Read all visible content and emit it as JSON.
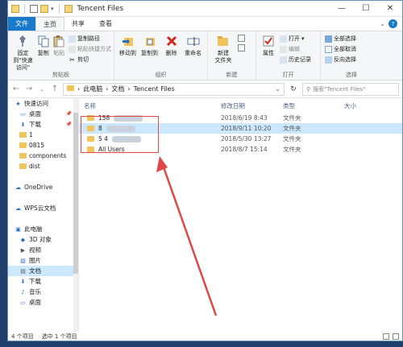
{
  "window": {
    "title": "Tencent Files"
  },
  "tabs": [
    {
      "label": "文件",
      "kind": "file"
    },
    {
      "label": "主页",
      "kind": "active"
    },
    {
      "label": "共享",
      "kind": "normal"
    },
    {
      "label": "查看",
      "kind": "normal"
    }
  ],
  "ribbon": {
    "clipboard": {
      "label": "剪贴板",
      "pin": "固定到\"快速访问\"",
      "copy": "复制",
      "paste": "粘贴",
      "copy_path": "复制路径",
      "paste_shortcut": "粘贴快捷方式",
      "cut": "剪切"
    },
    "organize": {
      "label": "组织",
      "move_to": "移动到",
      "copy_to": "复制到",
      "delete": "删除",
      "rename": "重命名"
    },
    "new": {
      "label": "新建",
      "new_folder": "新建\n文件夹"
    },
    "open": {
      "label": "打开",
      "properties": "属性",
      "open": "打开",
      "edit": "编辑",
      "history": "历史记录"
    },
    "select": {
      "label": "选择",
      "select_all": "全部选择",
      "select_none": "全部取消",
      "invert": "反向选择"
    }
  },
  "address": {
    "path": [
      "此电脑",
      "文档",
      "Tencent Files"
    ],
    "search_placeholder": "搜索\"Tencent Files\""
  },
  "sidebar": {
    "items": [
      {
        "label": "快速访问",
        "level": "lvl1",
        "icon": "star-icon"
      },
      {
        "label": "桌面",
        "level": "lvl2",
        "icon": "desktop-icon",
        "pinned": true
      },
      {
        "label": "下载",
        "level": "lvl2",
        "icon": "download-icon",
        "pinned": true
      },
      {
        "label": "1",
        "level": "lvl2",
        "icon": "folder-icon"
      },
      {
        "label": "0815",
        "level": "lvl2",
        "icon": "folder-icon"
      },
      {
        "label": "components",
        "level": "lvl2",
        "icon": "folder-icon"
      },
      {
        "label": "dist",
        "level": "lvl2",
        "icon": "folder-icon"
      },
      {
        "label": "",
        "level": "lvl2",
        "icon": ""
      },
      {
        "label": "OneDrive",
        "level": "lvl1",
        "icon": "cloud-icon"
      },
      {
        "label": "",
        "level": "lvl2",
        "icon": ""
      },
      {
        "label": "WPS云文档",
        "level": "lvl1",
        "icon": "cloud-icon"
      },
      {
        "label": "",
        "level": "lvl2",
        "icon": ""
      },
      {
        "label": "此电脑",
        "level": "lvl1",
        "icon": "computer-icon"
      },
      {
        "label": "3D 对象",
        "level": "lvl2",
        "icon": "cube-icon"
      },
      {
        "label": "视频",
        "level": "lvl2",
        "icon": "video-icon"
      },
      {
        "label": "图片",
        "level": "lvl2",
        "icon": "picture-icon"
      },
      {
        "label": "文档",
        "level": "lvl2",
        "icon": "document-icon",
        "selected": true
      },
      {
        "label": "下载",
        "level": "lvl2",
        "icon": "download-icon"
      },
      {
        "label": "音乐",
        "level": "lvl2",
        "icon": "music-icon"
      },
      {
        "label": "桌面",
        "level": "lvl2",
        "icon": "desktop-icon"
      }
    ]
  },
  "columns": {
    "name": "名称",
    "date": "修改日期",
    "type": "类型",
    "size": "大小"
  },
  "files": [
    {
      "name": "158",
      "date": "2018/6/19 8:43",
      "type": "文件夹",
      "selected": false
    },
    {
      "name": "8",
      "date": "2018/9/11 10:20",
      "type": "文件夹",
      "selected": true
    },
    {
      "name": "5 4",
      "date": "2018/5/30 13:27",
      "type": "文件夹",
      "selected": false
    },
    {
      "name": "All Users",
      "date": "2018/8/7 15:14",
      "type": "文件夹",
      "selected": false
    }
  ],
  "status": {
    "count": "4 个项目",
    "selected": "选中 1 个项目"
  },
  "colors": {
    "accent": "#1979ca",
    "selection": "#cce8ff",
    "folder": "#f2c55c",
    "annotation": "#e04747"
  }
}
